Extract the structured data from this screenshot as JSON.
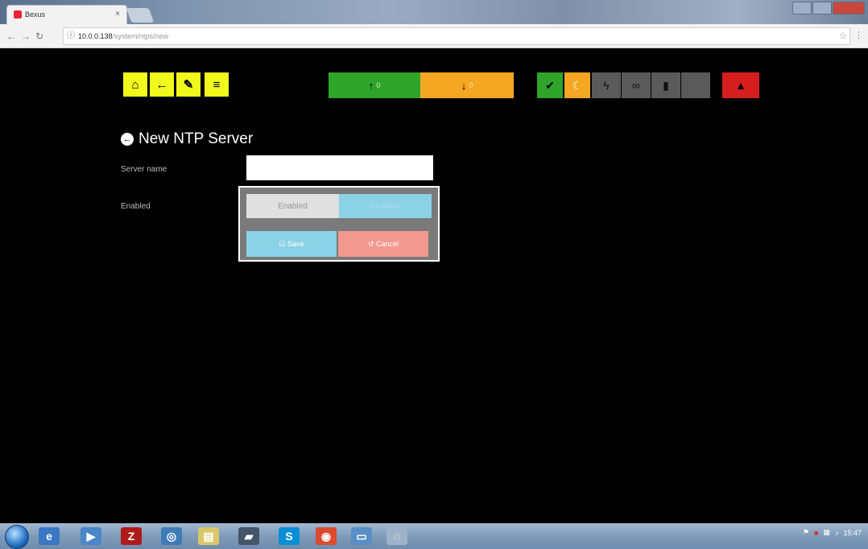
{
  "browser": {
    "tab_title": "Bexus",
    "tab_close": "×",
    "url_host": "10.0.0.138",
    "url_path": "/system/ntps/new",
    "info_icon": "ⓘ"
  },
  "nav_buttons": {
    "home": "⌂",
    "back": "←",
    "settings": "✎",
    "menu": "≡"
  },
  "status_bar": {
    "up_icon": "↑",
    "up_count": "0",
    "down_icon": "↓",
    "down_count": "0"
  },
  "status_icons": {
    "plug": "✔",
    "moon": "☾",
    "bolt": "ϟ",
    "link": "∞",
    "lock": "▮",
    "warning": "▲"
  },
  "page": {
    "title": "New NTP Server",
    "server_name_label": "Server name",
    "server_name_value": "",
    "enabled_label": "Enabled",
    "toggle_enabled": "Enabled",
    "toggle_disabled": "Disabled",
    "save_label": "☑ Save",
    "cancel_label": "↺ Cancel"
  },
  "tray": {
    "time": "15:47"
  },
  "colors": {
    "yellow": "#f0f81c",
    "green": "#2ea42a",
    "orange": "#f5a623",
    "grey": "#5a5a5a",
    "red": "#d51f1f"
  }
}
